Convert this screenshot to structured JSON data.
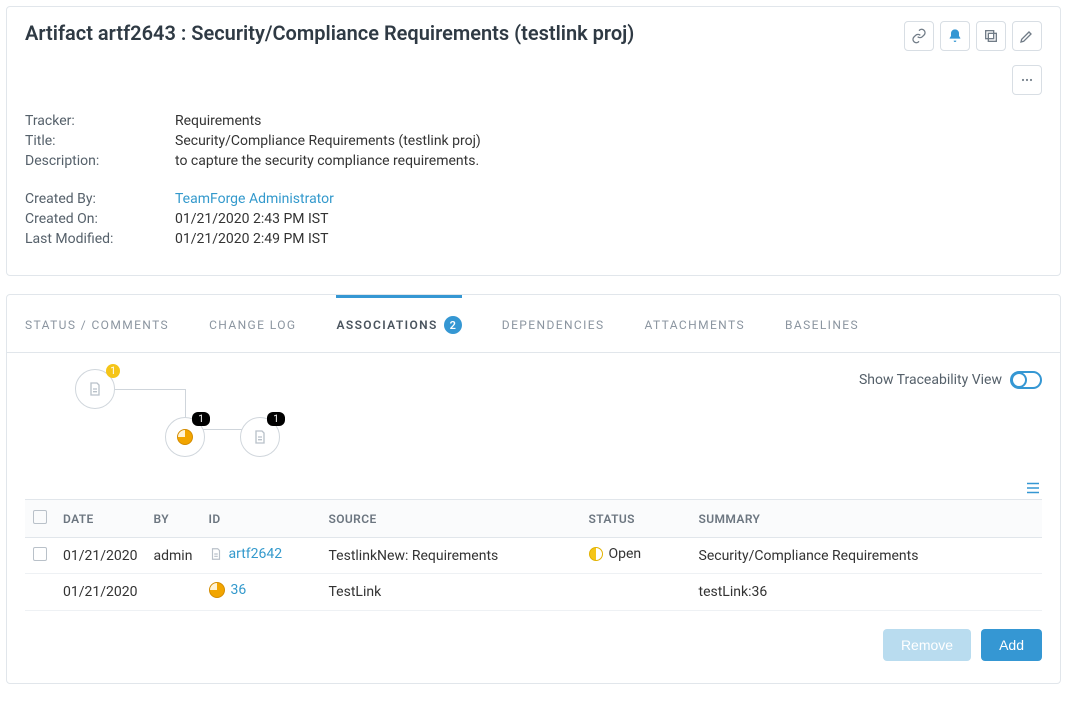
{
  "header": {
    "title": "Artifact artf2643 : Security/Compliance Requirements (testlink proj)"
  },
  "toolbar": {
    "link_icon_name": "link",
    "bell_icon_name": "bell",
    "copy_icon_name": "copy",
    "edit_icon_name": "edit",
    "more_icon_name": "more"
  },
  "spec": {
    "tracker_label": "Tracker:",
    "tracker_value": "Requirements",
    "title_label": "Title:",
    "title_value": "Security/Compliance Requirements (testlink proj)",
    "description_label": "Description:",
    "description_value": "to capture the security compliance requirements.",
    "created_by_label": "Created By:",
    "created_by_value": "TeamForge Administrator",
    "created_on_label": "Created On:",
    "created_on_value": "01/21/2020 2:43 PM IST",
    "last_modified_label": "Last Modified:",
    "last_modified_value": "01/21/2020 2:49 PM IST"
  },
  "tabs": {
    "status": "STATUS / COMMENTS",
    "changelog": "CHANGE LOG",
    "associations": "ASSOCIATIONS",
    "associations_count": "2",
    "dependencies": "DEPENDENCIES",
    "attachments": "ATTACHMENTS",
    "baselines": "BASELINES"
  },
  "associations": {
    "trace_label": "Show Traceability View",
    "diagram": {
      "root_badge": "1",
      "child1_badge": "1",
      "child2_badge": "1"
    },
    "columns": {
      "date": "DATE",
      "by": "BY",
      "id": "ID",
      "source": "SOURCE",
      "status": "STATUS",
      "summary": "SUMMARY"
    },
    "rows": [
      {
        "date": "01/21/2020",
        "by": "admin",
        "id": "artf2642",
        "source": "TestlinkNew: Requirements",
        "status": "Open",
        "summary": "Security/Compliance Requirements",
        "icon": "doc"
      },
      {
        "date": "01/21/2020",
        "by": "",
        "id": "36",
        "source": "TestLink",
        "status": "",
        "summary": "testLink:36",
        "icon": "pie"
      }
    ],
    "buttons": {
      "remove": "Remove",
      "add": "Add"
    }
  }
}
